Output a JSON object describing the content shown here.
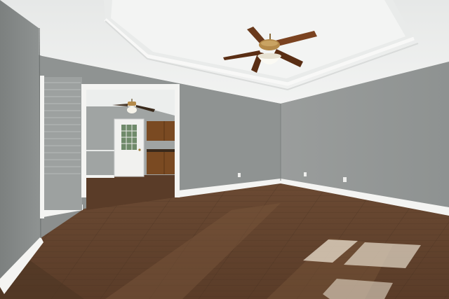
{
  "scene": {
    "kind": "photo-empty-room-interior",
    "colors": {
      "wall": "#8f9392",
      "wall_right": "#9a9d9c",
      "ceiling": "#eef0ef",
      "trim": "#f4f4f2",
      "floor_dark": "#4a3322",
      "floor_mid": "#6b4a33",
      "floor_light": "#8c6a4c",
      "cabinet": "#7a4a22",
      "door": "#f1f1ef",
      "fan_blade": "#6a3a1c",
      "fan_metal": "#b48a4a"
    },
    "elements": [
      "tray-ceiling",
      "ceiling-fan-main",
      "doorway-to-kitchen",
      "kitchen-ceiling-fan",
      "exterior-door",
      "kitchen-cabinets",
      "hardwood-floor",
      "sunlight-patches",
      "baseboard-trim",
      "wall-outlets"
    ]
  }
}
